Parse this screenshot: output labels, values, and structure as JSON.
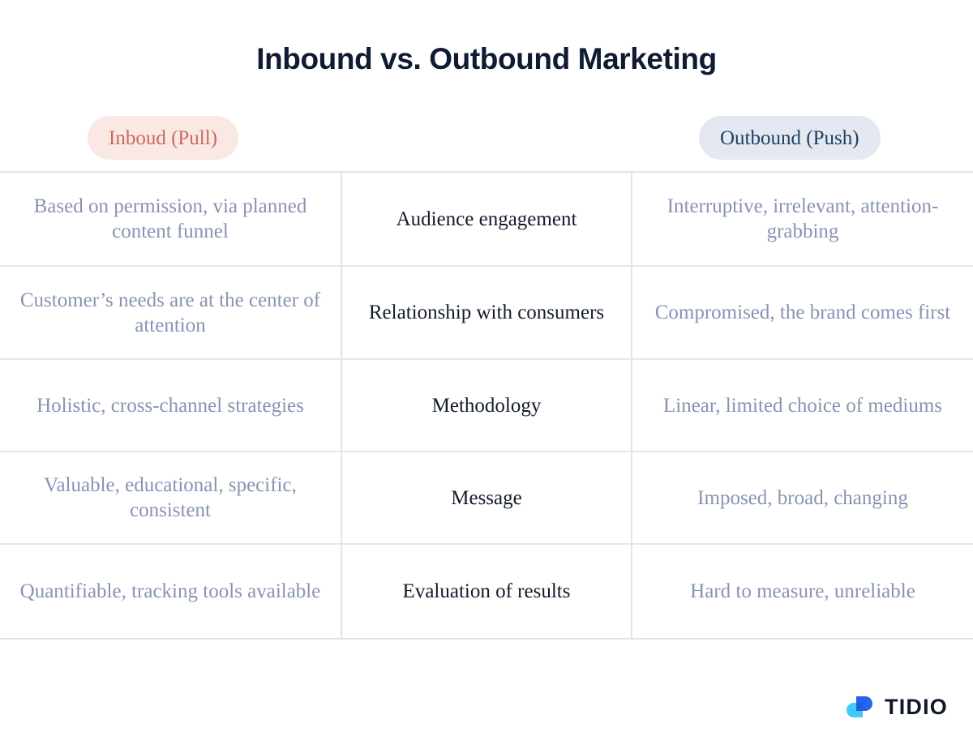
{
  "header": {
    "title": "Inbound vs. Outbound Marketing"
  },
  "columns": {
    "left_pill": "Inboud (Pull)",
    "middle_pill": "",
    "right_pill": "Outbound (Push)"
  },
  "colors": {
    "title": "#0f1b33",
    "inbound_pill_bg": "#fae8e4",
    "inbound_pill_text": "#cb6a5c",
    "outbound_pill_bg": "#e4e9f1",
    "outbound_pill_text": "#1f3f63",
    "side_cell_text": "#8793b2",
    "middle_cell_text": "#131b2b",
    "grid_line": "#dfe3ec",
    "logo_dark_blue": "#2563f0",
    "logo_light_blue": "#2fc6f7"
  },
  "table": {
    "rows": [
      {
        "inbound": "Based on permission, via planned content funnel",
        "criterion": "Audience engagement",
        "outbound": "Interruptive, irrelevant, attention-grabbing"
      },
      {
        "inbound": "Customer’s needs are at the center of attention",
        "criterion": "Relationship with consumers",
        "outbound": "Compromised, the brand comes first"
      },
      {
        "inbound": "Holistic, cross-channel strategies",
        "criterion": "Methodology",
        "outbound": "Linear, limited choice of mediums"
      },
      {
        "inbound": "Valuable, educational, specific, consistent",
        "criterion": "Message",
        "outbound": "Imposed, broad, changing"
      },
      {
        "inbound": "Quantifiable, tracking tools available",
        "criterion": "Evaluation of results",
        "outbound": "Hard to measure, unreliable"
      }
    ]
  },
  "footer": {
    "brand": "TIDIO"
  }
}
